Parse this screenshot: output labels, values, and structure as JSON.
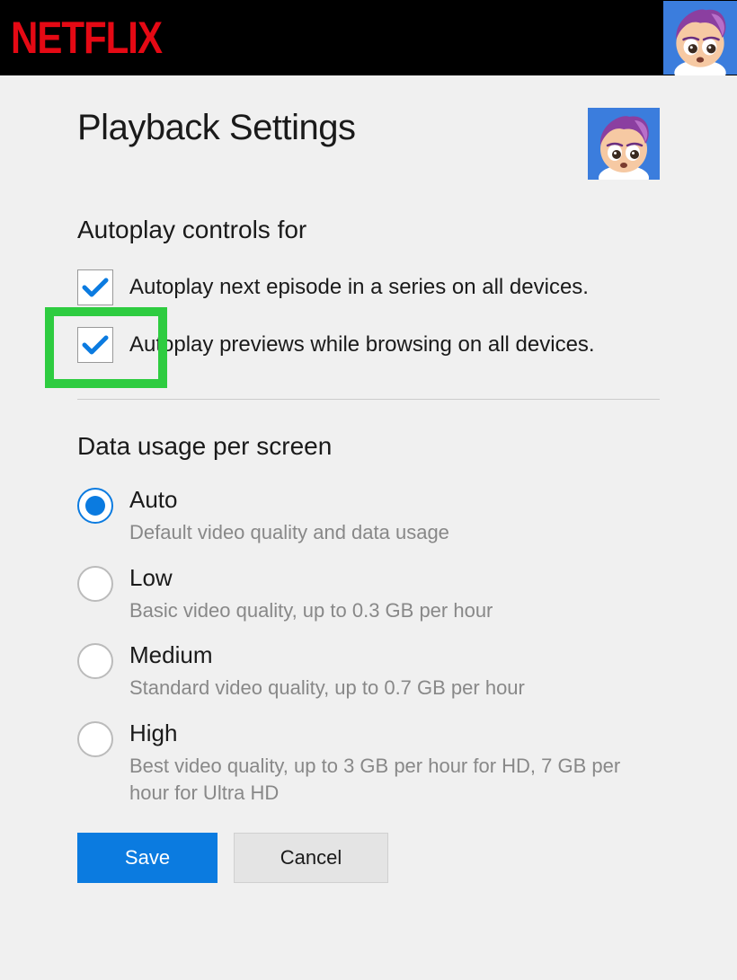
{
  "brand": "NETFLIX",
  "page_title": "Playback Settings",
  "autoplay": {
    "heading": "Autoplay controls for",
    "options": [
      {
        "label": "Autoplay next episode in a series on all devices.",
        "checked": true
      },
      {
        "label": "Autoplay previews while browsing on all devices.",
        "checked": true,
        "highlighted": true
      }
    ]
  },
  "data_usage": {
    "heading": "Data usage per screen",
    "options": [
      {
        "label": "Auto",
        "desc": "Default video quality and data usage",
        "selected": true
      },
      {
        "label": "Low",
        "desc": "Basic video quality, up to 0.3 GB per hour",
        "selected": false
      },
      {
        "label": "Medium",
        "desc": "Standard video quality, up to 0.7 GB per hour",
        "selected": false
      },
      {
        "label": "High",
        "desc": "Best video quality, up to 3 GB per hour for HD, 7 GB per hour for Ultra HD",
        "selected": false
      }
    ]
  },
  "buttons": {
    "save": "Save",
    "cancel": "Cancel"
  }
}
